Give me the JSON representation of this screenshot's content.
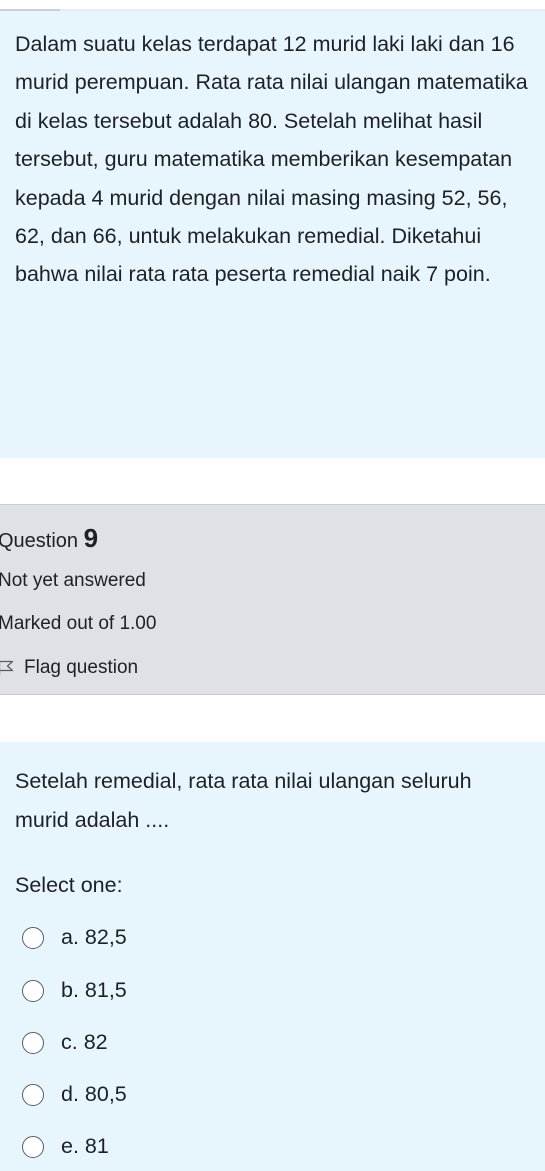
{
  "context": {
    "text": "Dalam suatu kelas terdapat 12 murid laki laki dan 16 murid perempuan. Rata rata nilai ulangan matematika di kelas tersebut adalah 80. Setelah melihat hasil tersebut, guru matematika memberikan kesempatan kepada 4 murid dengan nilai masing masing 52, 56, 62, dan 66, untuk melakukan remedial. Diketahui bahwa nilai rata rata peserta remedial naik 7 poin."
  },
  "question_info": {
    "heading_label": "Question",
    "number": "9",
    "state": "Not yet answered",
    "grade": "Marked out of 1.00",
    "flag_label": "Flag question",
    "flag_icon": "flag-icon"
  },
  "question": {
    "text": "Setelah remedial, rata rata nilai ulangan seluruh murid adalah ....",
    "prompt": "Select one:",
    "answers": [
      {
        "label": "a. 82,5"
      },
      {
        "label": "b. 81,5"
      },
      {
        "label": "c. 82"
      },
      {
        "label": "d. 80,5"
      },
      {
        "label": "e. 81"
      }
    ]
  },
  "colors": {
    "content_bg": "#e7f6fd",
    "info_bg": "#dee2e6",
    "text": "#1d2125"
  }
}
